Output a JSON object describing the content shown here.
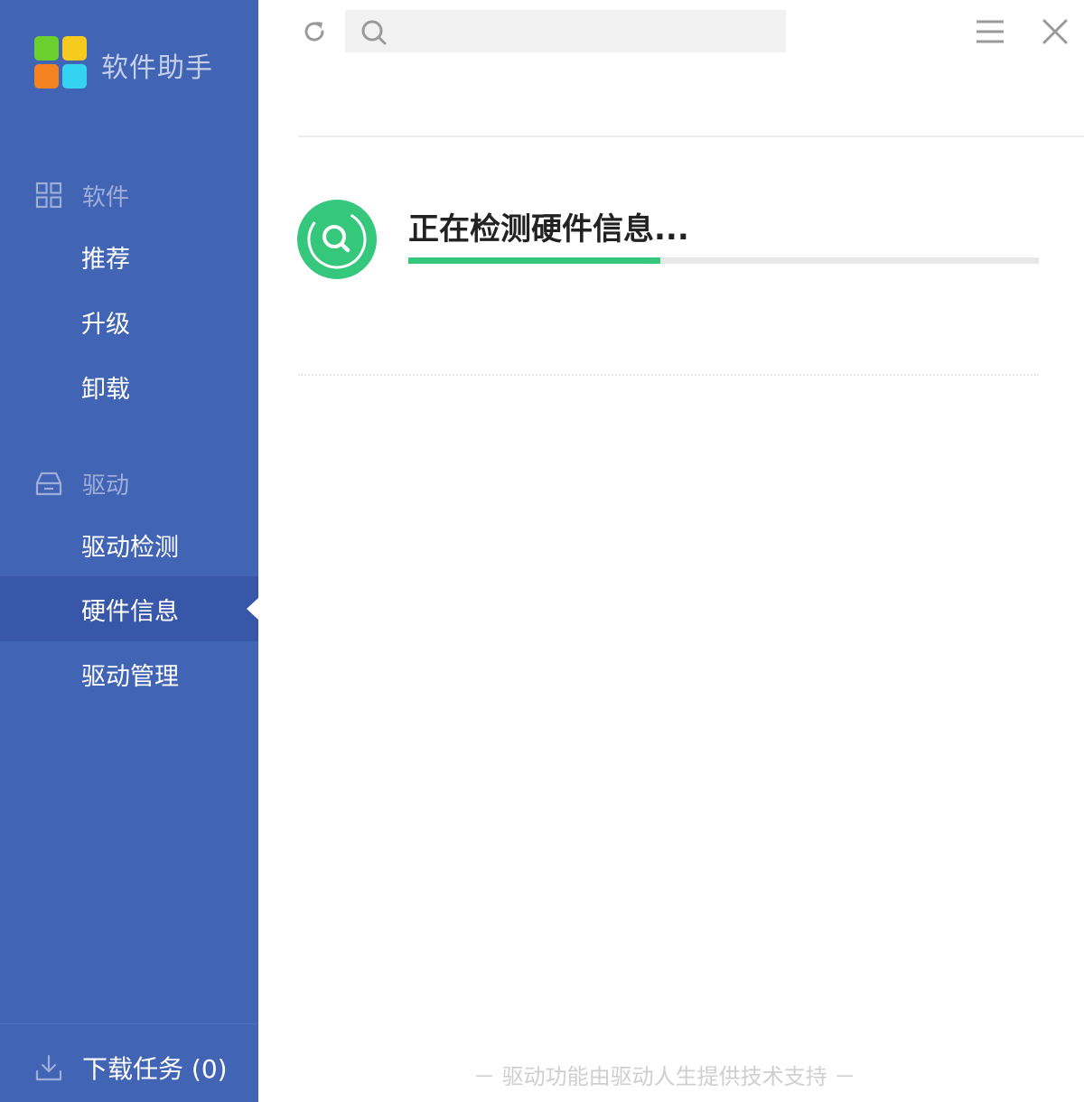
{
  "app": {
    "name": "软件助手"
  },
  "sidebar": {
    "software_section": {
      "label": "软件",
      "items": [
        {
          "label": "推荐"
        },
        {
          "label": "升级"
        },
        {
          "label": "卸载"
        }
      ]
    },
    "driver_section": {
      "label": "驱动",
      "items": [
        {
          "label": "驱动检测"
        },
        {
          "label": "硬件信息",
          "active": true
        },
        {
          "label": "驱动管理"
        }
      ]
    },
    "download_label": "下载任务 (0)"
  },
  "toolbar": {
    "refresh_icon": "refresh-icon",
    "search_placeholder": "",
    "menu_icon": "hamburger-menu-icon",
    "close_icon": "close-icon"
  },
  "status": {
    "title": "正在检测硬件信息...",
    "progress": 0.4
  },
  "footer": {
    "note": "－ 驱动功能由驱动人生提供技术支持 －"
  },
  "colors": {
    "sidebar": "#4264b5",
    "sidebar_active": "#3857a8",
    "accent_green": "#35c77c"
  }
}
